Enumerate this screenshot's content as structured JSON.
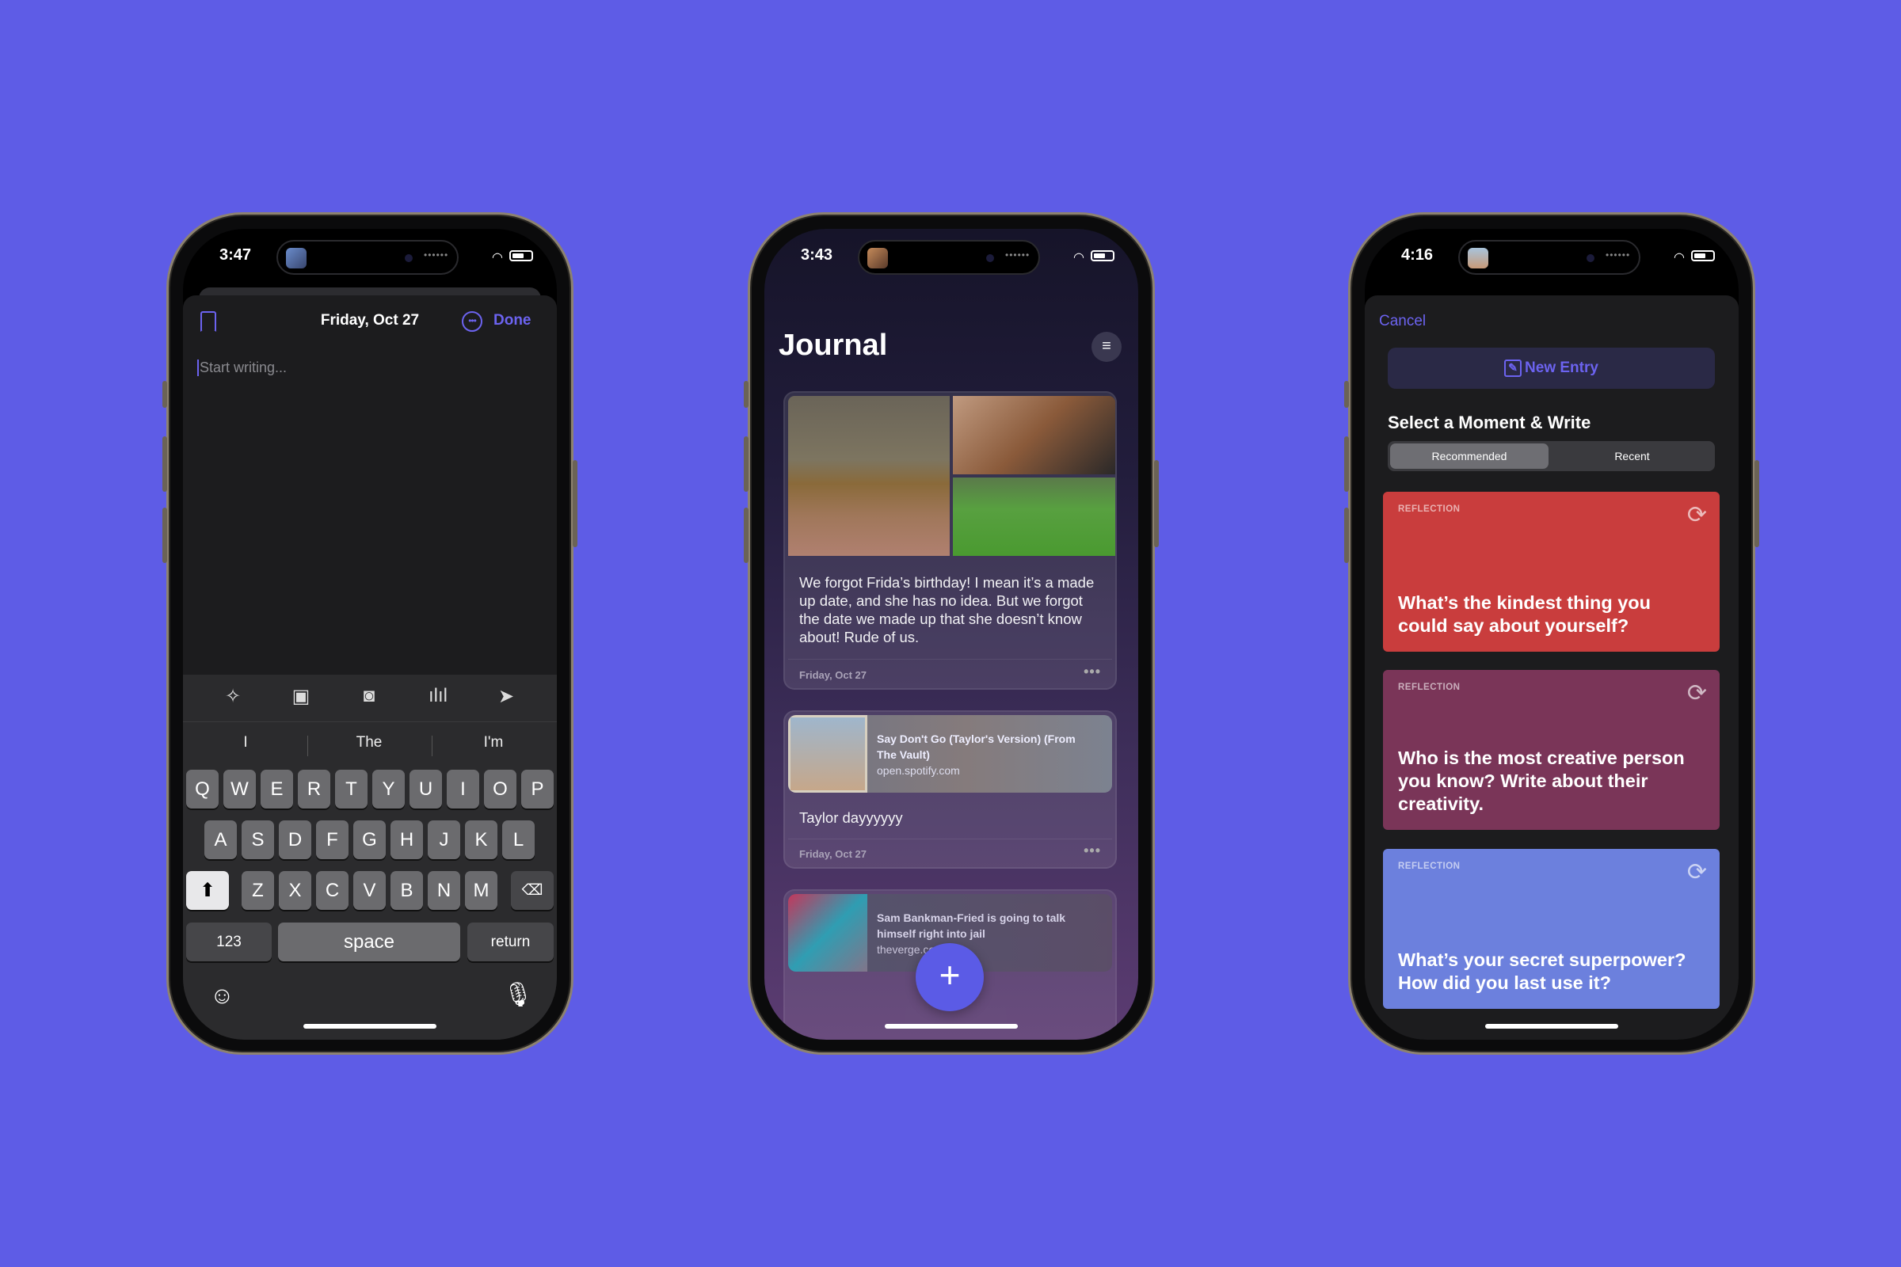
{
  "colors": {
    "background": "#5e5ce6",
    "accent": "#6c63f0",
    "reflection_red": "#c93d3d",
    "reflection_plum": "#7a3558",
    "reflection_blue": "#6c80dd"
  },
  "phone1": {
    "status": {
      "time": "3:47"
    },
    "header": {
      "bookmark_icon": "bookmark-icon",
      "title": "Friday, Oct 27",
      "more_icon": "ellipsis-circle-icon",
      "done_label": "Done"
    },
    "editor": {
      "placeholder": "Start writing..."
    },
    "toolbar": [
      "magic-wand-icon",
      "photo-library-icon",
      "camera-icon",
      "waveform-icon",
      "location-arrow-icon"
    ],
    "suggestions": [
      "I",
      "The",
      "I'm"
    ],
    "keyboard": {
      "row1": [
        "Q",
        "W",
        "E",
        "R",
        "T",
        "Y",
        "U",
        "I",
        "O",
        "P"
      ],
      "row2": [
        "A",
        "S",
        "D",
        "F",
        "G",
        "H",
        "J",
        "K",
        "L"
      ],
      "row3": [
        "Z",
        "X",
        "C",
        "V",
        "B",
        "N",
        "M"
      ],
      "numbers": "123",
      "space": "space",
      "return": "return"
    }
  },
  "phone2": {
    "status": {
      "time": "3:43"
    },
    "title": "Journal",
    "entries": [
      {
        "text": "We forgot Frida’s birthday! I mean it’s a made up date, and she has no idea. But we forgot the date we made up that she doesn’t know about! Rude of us.",
        "date": "Friday, Oct 27"
      },
      {
        "link_title": "Say Don't Go (Taylor's Version) (From The Vault)",
        "link_url": "open.spotify.com",
        "text": "Taylor dayyyyyy",
        "date": "Friday, Oct 27"
      },
      {
        "link_title": "Sam Bankman-Fried is going to talk himself right into jail",
        "link_url": "theverge.com"
      }
    ]
  },
  "phone3": {
    "status": {
      "time": "4:16"
    },
    "cancel": "Cancel",
    "new_entry": "New Entry",
    "section_title": "Select a Moment & Write",
    "segments": [
      "Recommended",
      "Recent"
    ],
    "selected_segment": "Recommended",
    "prompts": [
      {
        "label": "REFLECTION",
        "question": "What’s the kindest thing you could say about yourself?"
      },
      {
        "label": "REFLECTION",
        "question": "Who is the most creative person you know? Write about their creativity."
      },
      {
        "label": "REFLECTION",
        "question": "What’s your secret superpower? How did you last use it?"
      }
    ]
  }
}
